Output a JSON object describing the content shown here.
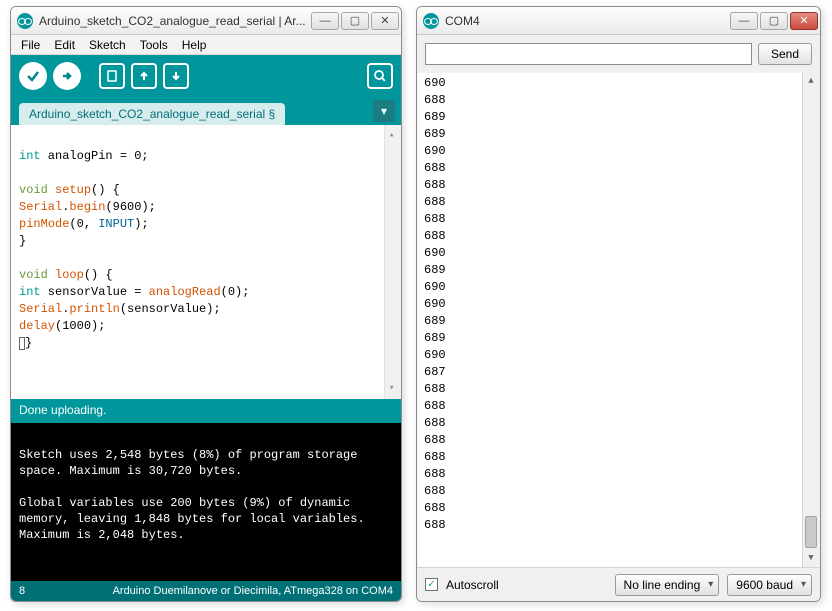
{
  "ide": {
    "title": "Arduino_sketch_CO2_analogue_read_serial | Ar...",
    "menu": [
      "File",
      "Edit",
      "Sketch",
      "Tools",
      "Help"
    ],
    "tab": "Arduino_sketch_CO2_analogue_read_serial §",
    "code": {
      "l1a": "int",
      "l1b": " analogPin = 0;",
      "l2a": "void",
      "l2b": " setup",
      "l2c": "() {",
      "l3a": "Serial",
      "l3b": ".",
      "l3c": "begin",
      "l3d": "(9600);",
      "l4a": "pinMode",
      "l4b": "(0, ",
      "l4c": "INPUT",
      "l4d": ");",
      "l5": "}",
      "l6a": "void",
      "l6b": " loop",
      "l6c": "() {",
      "l7a": "int",
      "l7b": " sensorValue = ",
      "l7c": "analogRead",
      "l7d": "(0);",
      "l8a": "Serial",
      "l8b": ".",
      "l8c": "println",
      "l8d": "(sensorValue);",
      "l9a": "delay",
      "l9b": "(1000);"
    },
    "status": "Done uploading.",
    "console": "\nSketch uses 2,548 bytes (8%) of program storage space. Maximum is 30,720 bytes.\n\nGlobal variables use 200 bytes (9%) of dynamic memory, leaving 1,848 bytes for local variables. Maximum is 2,048 bytes.\n",
    "footer_left": "8",
    "footer_right": "Arduino Duemilanove or Diecimila, ATmega328 on COM4"
  },
  "serial": {
    "title": "COM4",
    "send_label": "Send",
    "input_value": "",
    "lines": [
      "690",
      "688",
      "689",
      "689",
      "690",
      "688",
      "688",
      "688",
      "688",
      "688",
      "690",
      "689",
      "690",
      "690",
      "689",
      "689",
      "690",
      "687",
      "688",
      "688",
      "688",
      "688",
      "688",
      "688",
      "688",
      "688",
      "688"
    ],
    "autoscroll_label": "Autoscroll",
    "autoscroll_checked": true,
    "line_ending": "No line ending",
    "baud": "9600 baud"
  }
}
